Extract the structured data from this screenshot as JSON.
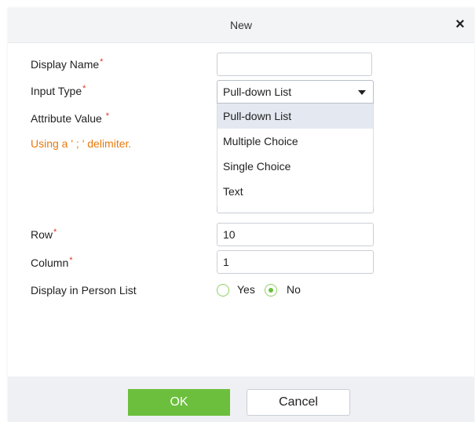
{
  "dialog": {
    "title": "New",
    "close_glyph": "×"
  },
  "form": {
    "display_name": {
      "label": "Display Name",
      "required_mark": "*",
      "value": ""
    },
    "input_type": {
      "label": "Input Type",
      "required_mark": "*",
      "value": "Pull-down List",
      "caret_icon": "caret-down-icon"
    },
    "attribute_value": {
      "label": "Attribute Value ",
      "required_mark": "*",
      "hint": "Using a ' ; ' delimiter."
    },
    "row": {
      "label": "Row",
      "required_mark": "*",
      "value": "10"
    },
    "column": {
      "label": "Column",
      "required_mark": "*",
      "value": "1"
    },
    "display_in_person_list": {
      "label": "Display in Person List",
      "yes_label": "Yes",
      "no_label": "No",
      "selected": "No"
    }
  },
  "dropdown": {
    "options": [
      "Pull-down List",
      "Multiple Choice",
      "Single Choice",
      "Text"
    ],
    "selected_index": 0
  },
  "footer": {
    "ok_label": "OK",
    "cancel_label": "Cancel"
  },
  "colors": {
    "accent_green": "#6cbf3c",
    "required_red": "#e0352b",
    "hint_orange": "#e8790c",
    "header_bg": "#f3f4f6",
    "footer_bg": "#eef0f3",
    "option_selected_bg": "#e4e9f1"
  }
}
